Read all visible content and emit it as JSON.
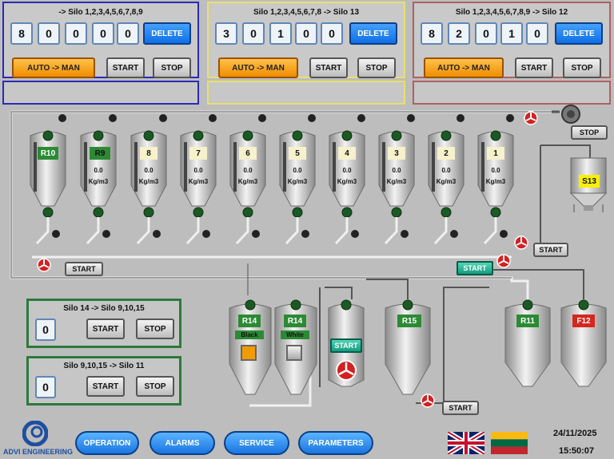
{
  "panels": [
    {
      "title": "-> Silo 1,2,3,4,5,6,7,8,9",
      "digits": [
        "8",
        "0",
        "0",
        "0",
        "0"
      ],
      "delete": "DELETE",
      "mode": "AUTO -> MAN",
      "start": "START",
      "stop": "STOP",
      "color": "#2a2ab8"
    },
    {
      "title": "Silo 1,2,3,4,5,6,7,8 -> Silo 13",
      "digits": [
        "3",
        "0",
        "1",
        "0",
        "0"
      ],
      "delete": "DELETE",
      "mode": "AUTO -> MAN",
      "start": "START",
      "stop": "STOP",
      "color": "#e8e070"
    },
    {
      "title": "Silo 1,2,3,4,5,6,7,8,9 -> Silo 12",
      "digits": [
        "8",
        "2",
        "0",
        "1",
        "0"
      ],
      "delete": "DELETE",
      "mode": "AUTO -> MAN",
      "start": "START",
      "stop": "STOP",
      "color": "#b06060"
    }
  ],
  "silos": [
    {
      "label": "R10",
      "style": "green",
      "value": "",
      "unit": ""
    },
    {
      "label": "R9",
      "style": "green-dark",
      "value": "0.0",
      "unit": "Kg/m3"
    },
    {
      "label": "8",
      "style": "cream",
      "value": "0.0",
      "unit": "Kg/m3"
    },
    {
      "label": "7",
      "style": "cream",
      "value": "0.0",
      "unit": "Kg/m3"
    },
    {
      "label": "6",
      "style": "cream",
      "value": "0.0",
      "unit": "Kg/m3"
    },
    {
      "label": "5",
      "style": "cream",
      "value": "0.0",
      "unit": "Kg/m3"
    },
    {
      "label": "4",
      "style": "cream",
      "value": "0.0",
      "unit": "Kg/m3"
    },
    {
      "label": "3",
      "style": "cream",
      "value": "0.0",
      "unit": "Kg/m3"
    },
    {
      "label": "2",
      "style": "cream",
      "value": "0.0",
      "unit": "Kg/m3"
    },
    {
      "label": "1",
      "style": "cream",
      "value": "0.0",
      "unit": "Kg/m3"
    }
  ],
  "s13": {
    "label": "S13"
  },
  "buttons": {
    "stop_top": "STOP",
    "start_left": "START",
    "start_teal": "START",
    "start_right": "START",
    "start_mixer": "START",
    "start_bottom": "START"
  },
  "lower_silos": {
    "r14_black": {
      "label": "R14",
      "sub": "Black"
    },
    "r14_white": {
      "label": "R14",
      "sub": "White"
    },
    "r15": {
      "label": "R15"
    },
    "r11": {
      "label": "R11"
    },
    "f12": {
      "label": "F12"
    }
  },
  "gpanels": [
    {
      "title": "Silo 14 -> Silo 9,10,15",
      "value": "0",
      "start": "START",
      "stop": "STOP"
    },
    {
      "title": "Silo 9,10,15 -> Silo 11",
      "value": "0",
      "start": "START",
      "stop": "STOP"
    }
  ],
  "brand": "ADVI ENGINEERING",
  "nav": [
    "OPERATION",
    "ALARMS",
    "SERVICE",
    "PARAMETERS"
  ],
  "date": "24/11/2025",
  "time": "15:50:07",
  "colors": {
    "accent": "#1a76e2",
    "panel_border": "#2c7a3a",
    "run_red": "#d5271f"
  }
}
